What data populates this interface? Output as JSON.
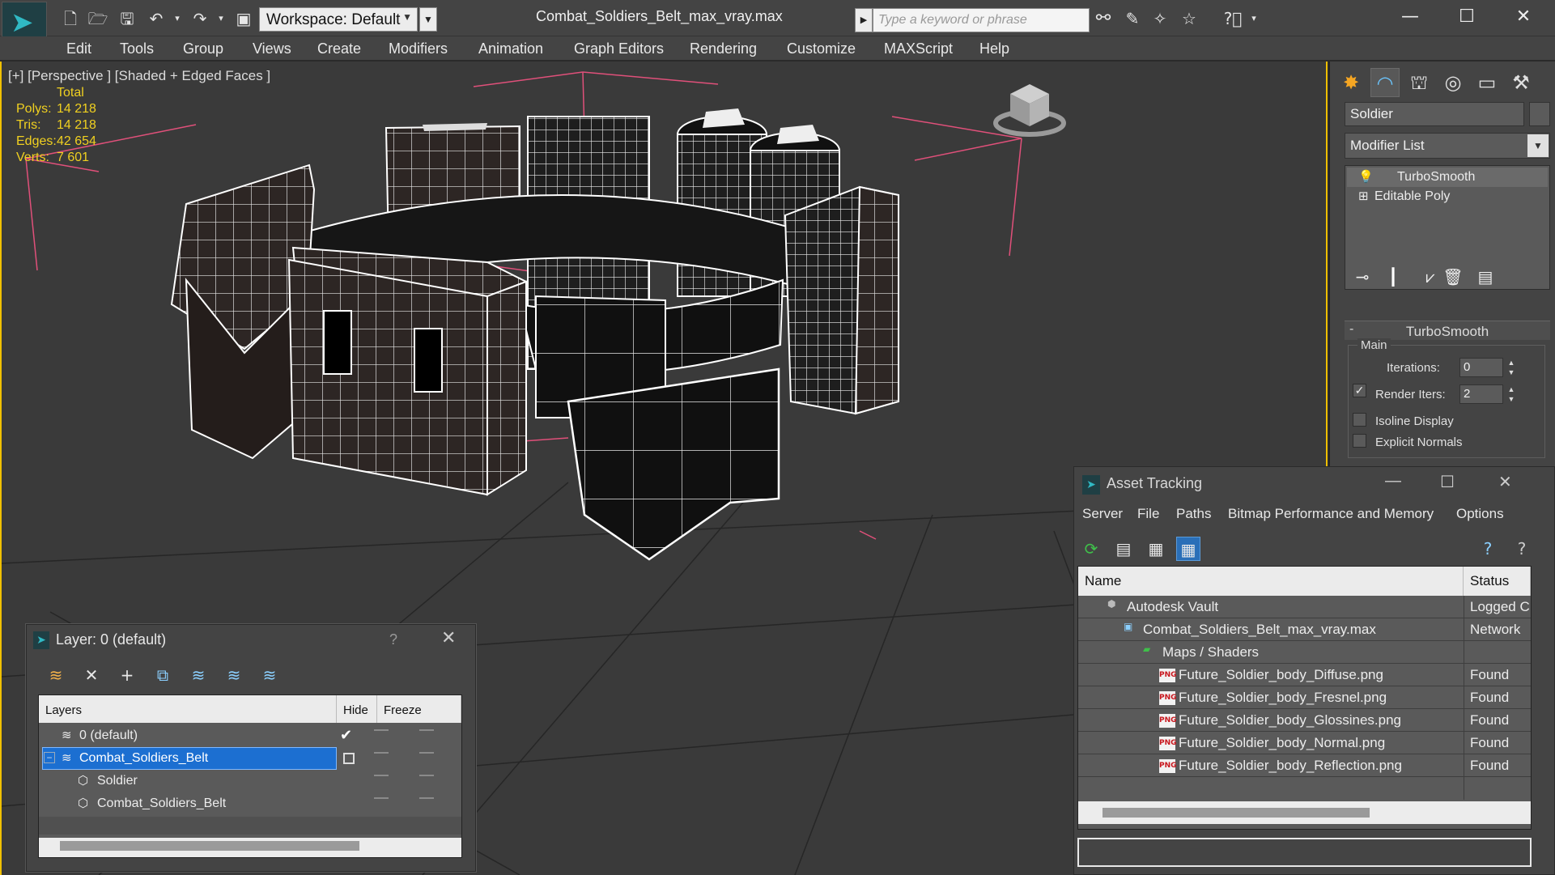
{
  "titlebar": {
    "workspace": "Workspace: Default",
    "document_title": "Combat_Soldiers_Belt_max_vray.max",
    "search_placeholder": "Type a keyword or phrase"
  },
  "menu": [
    "Edit",
    "Tools",
    "Group",
    "Views",
    "Create",
    "Modifiers",
    "Animation",
    "Graph Editors",
    "Rendering",
    "Customize",
    "MAXScript",
    "Help"
  ],
  "viewport": {
    "label": "[+] [Perspective ] [Shaded + Edged Faces ]",
    "stats_header": "Total",
    "stats": [
      {
        "label": "Polys:",
        "value": "14 218"
      },
      {
        "label": "Tris:",
        "value": "14 218"
      },
      {
        "label": "Edges:",
        "value": "42 654"
      },
      {
        "label": "Verts:",
        "value": "7 601"
      }
    ]
  },
  "command_panel": {
    "object_name": "Soldier",
    "modifier_list": "Modifier List",
    "stack": [
      {
        "label": "TurboSmooth",
        "icon": "light-bulb-icon",
        "selected": true
      },
      {
        "label": "Editable Poly",
        "icon": "plus-expand-icon",
        "selected": false
      }
    ],
    "rollout_title": "TurboSmooth",
    "group_main": "Main",
    "iterations_label": "Iterations:",
    "iterations_value": "0",
    "render_iters_label": "Render Iters:",
    "render_iters_value": "2",
    "render_iters_checked": true,
    "isoline_label": "Isoline Display",
    "explicit_normals_label": "Explicit Normals"
  },
  "layer_window": {
    "title": "Layer: 0 (default)",
    "help": "?",
    "columns": [
      "Layers",
      "Hide",
      "Freeze"
    ],
    "rows": [
      {
        "name": "0 (default)",
        "indent": 1,
        "icon": "layer-icon",
        "active_check": "✔"
      },
      {
        "name": "Combat_Soldiers_Belt",
        "indent": 1,
        "icon": "layer-icon",
        "selected": true
      },
      {
        "name": "Soldier",
        "indent": 2,
        "icon": "object-icon"
      },
      {
        "name": "Combat_Soldiers_Belt",
        "indent": 2,
        "icon": "object-icon"
      }
    ]
  },
  "asset_window": {
    "title": "Asset Tracking",
    "menu": [
      "Server",
      "File",
      "Paths",
      "Bitmap Performance and Memory",
      "Options"
    ],
    "columns": [
      "Name",
      "Status"
    ],
    "rows": [
      {
        "name": "Autodesk Vault",
        "status": "Logged C",
        "indent": 1,
        "icon": "vault-icon"
      },
      {
        "name": "Combat_Soldiers_Belt_max_vray.max",
        "status": "Network",
        "indent": 2,
        "icon": "max-file-icon"
      },
      {
        "name": "Maps / Shaders",
        "status": "",
        "indent": 3,
        "icon": "maps-folder-icon"
      },
      {
        "name": "Future_Soldier_body_Diffuse.png",
        "status": "Found",
        "indent": 4,
        "icon": "png-icon"
      },
      {
        "name": "Future_Soldier_body_Fresnel.png",
        "status": "Found",
        "indent": 4,
        "icon": "png-icon"
      },
      {
        "name": "Future_Soldier_body_Glossines.png",
        "status": "Found",
        "indent": 4,
        "icon": "png-icon"
      },
      {
        "name": "Future_Soldier_body_Normal.png",
        "status": "Found",
        "indent": 4,
        "icon": "png-icon"
      },
      {
        "name": "Future_Soldier_body_Reflection.png",
        "status": "Found",
        "indent": 4,
        "icon": "png-icon"
      }
    ]
  },
  "colors": {
    "viewport_border": "#f0c000",
    "stats_text": "#f0d020",
    "selection": "#2a6fb8",
    "camera_lines": "#e0507a"
  }
}
